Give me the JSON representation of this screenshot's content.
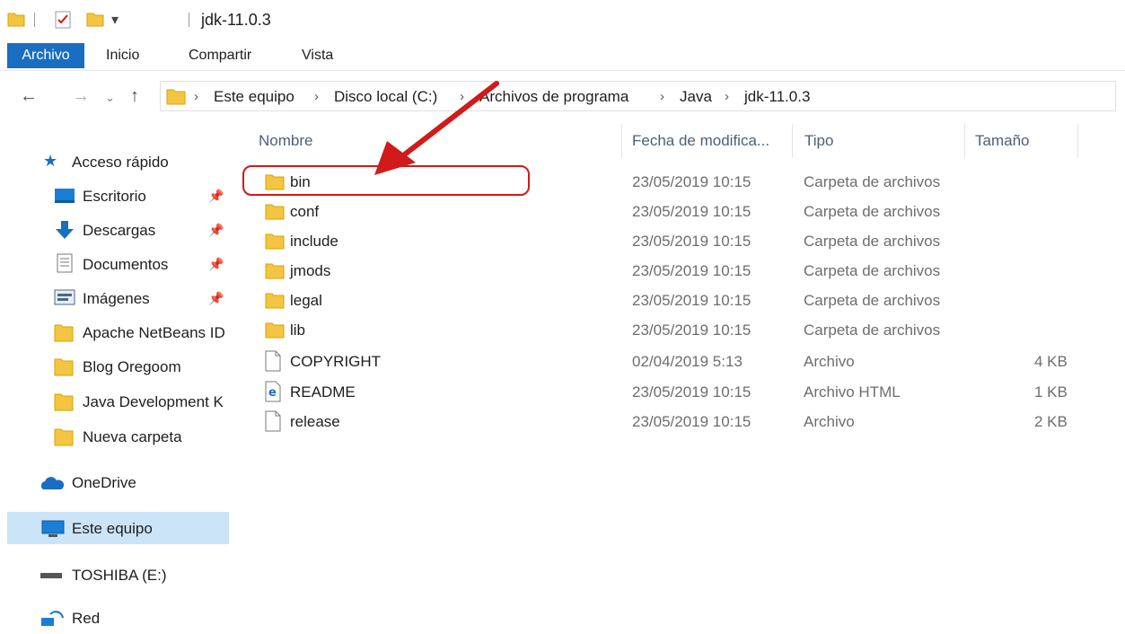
{
  "window": {
    "title": "jdk-11.0.3"
  },
  "ribbon": {
    "tabs": [
      "Archivo",
      "Inicio",
      "Compartir",
      "Vista"
    ]
  },
  "breadcrumb": [
    "Este equipo",
    "Disco local (C:)",
    "Archivos de programa",
    "Java",
    "jdk-11.0.3"
  ],
  "columns": {
    "name": "Nombre",
    "date": "Fecha de modifica...",
    "type": "Tipo",
    "size": "Tamaño"
  },
  "sidebar": {
    "quick_access": "Acceso rápido",
    "items": [
      {
        "label": "Escritorio",
        "icon": "desktop-icon",
        "pinned": true
      },
      {
        "label": "Descargas",
        "icon": "download-icon",
        "pinned": true
      },
      {
        "label": "Documentos",
        "icon": "documents-icon",
        "pinned": true
      },
      {
        "label": "Imágenes",
        "icon": "pictures-icon",
        "pinned": true
      },
      {
        "label": "Apache NetBeans ID",
        "icon": "folder-icon",
        "pinned": false
      },
      {
        "label": "Blog Oregoom",
        "icon": "folder-icon",
        "pinned": false
      },
      {
        "label": "Java Development K",
        "icon": "folder-icon",
        "pinned": false
      },
      {
        "label": "Nueva carpeta",
        "icon": "folder-icon",
        "pinned": false
      }
    ],
    "onedrive": "OneDrive",
    "this_pc": "Este equipo",
    "drive": "TOSHIBA (E:)",
    "network": "Red"
  },
  "files": [
    {
      "name": "bin",
      "date": "23/05/2019 10:15",
      "type": "Carpeta de archivos",
      "size": "",
      "icon": "folder-icon"
    },
    {
      "name": "conf",
      "date": "23/05/2019 10:15",
      "type": "Carpeta de archivos",
      "size": "",
      "icon": "folder-icon"
    },
    {
      "name": "include",
      "date": "23/05/2019 10:15",
      "type": "Carpeta de archivos",
      "size": "",
      "icon": "folder-icon"
    },
    {
      "name": "jmods",
      "date": "23/05/2019 10:15",
      "type": "Carpeta de archivos",
      "size": "",
      "icon": "folder-icon"
    },
    {
      "name": "legal",
      "date": "23/05/2019 10:15",
      "type": "Carpeta de archivos",
      "size": "",
      "icon": "folder-icon"
    },
    {
      "name": "lib",
      "date": "23/05/2019 10:15",
      "type": "Carpeta de archivos",
      "size": "",
      "icon": "folder-icon"
    },
    {
      "name": "COPYRIGHT",
      "date": "02/04/2019 5:13",
      "type": "Archivo",
      "size": "4 KB",
      "icon": "file-icon"
    },
    {
      "name": "README",
      "date": "23/05/2019 10:15",
      "type": "Archivo HTML",
      "size": "1 KB",
      "icon": "html-file-icon"
    },
    {
      "name": "release",
      "date": "23/05/2019 10:15",
      "type": "Archivo",
      "size": "2 KB",
      "icon": "file-icon"
    }
  ],
  "colors": {
    "accent": "#1a6ec1",
    "selected": "#cce4f7",
    "annotation": "#d11a1a",
    "folder": "#f4c542"
  }
}
